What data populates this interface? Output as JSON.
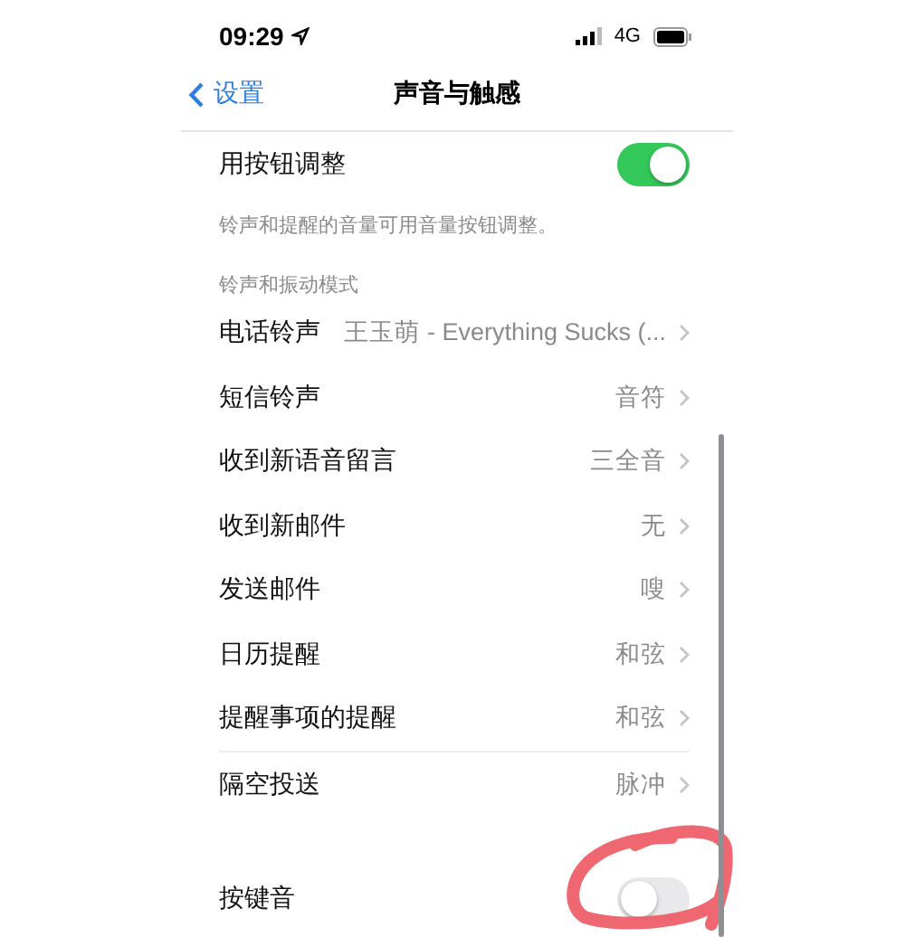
{
  "status_bar": {
    "time": "09:29",
    "network": "4G"
  },
  "nav": {
    "back": "设置",
    "title": "声音与触感"
  },
  "volume_row": {
    "label": "用按钮调整",
    "on": true
  },
  "volume_note": "铃声和提醒的音量可用音量按钮调整。",
  "section_header": "铃声和振动模式",
  "sound_rows": [
    {
      "label": "电话铃声",
      "value": "王玉萌 - Everything Sucks (..."
    },
    {
      "label": "短信铃声",
      "value": "音符"
    },
    {
      "label": "收到新语音留言",
      "value": "三全音"
    },
    {
      "label": "收到新邮件",
      "value": "无"
    },
    {
      "label": "发送邮件",
      "value": "嗖"
    },
    {
      "label": "日历提醒",
      "value": "和弦"
    },
    {
      "label": "提醒事项的提醒",
      "value": "和弦"
    },
    {
      "label": "隔空投送",
      "value": "脉冲"
    }
  ],
  "keyboard_row": {
    "label": "按键音",
    "on": false
  }
}
